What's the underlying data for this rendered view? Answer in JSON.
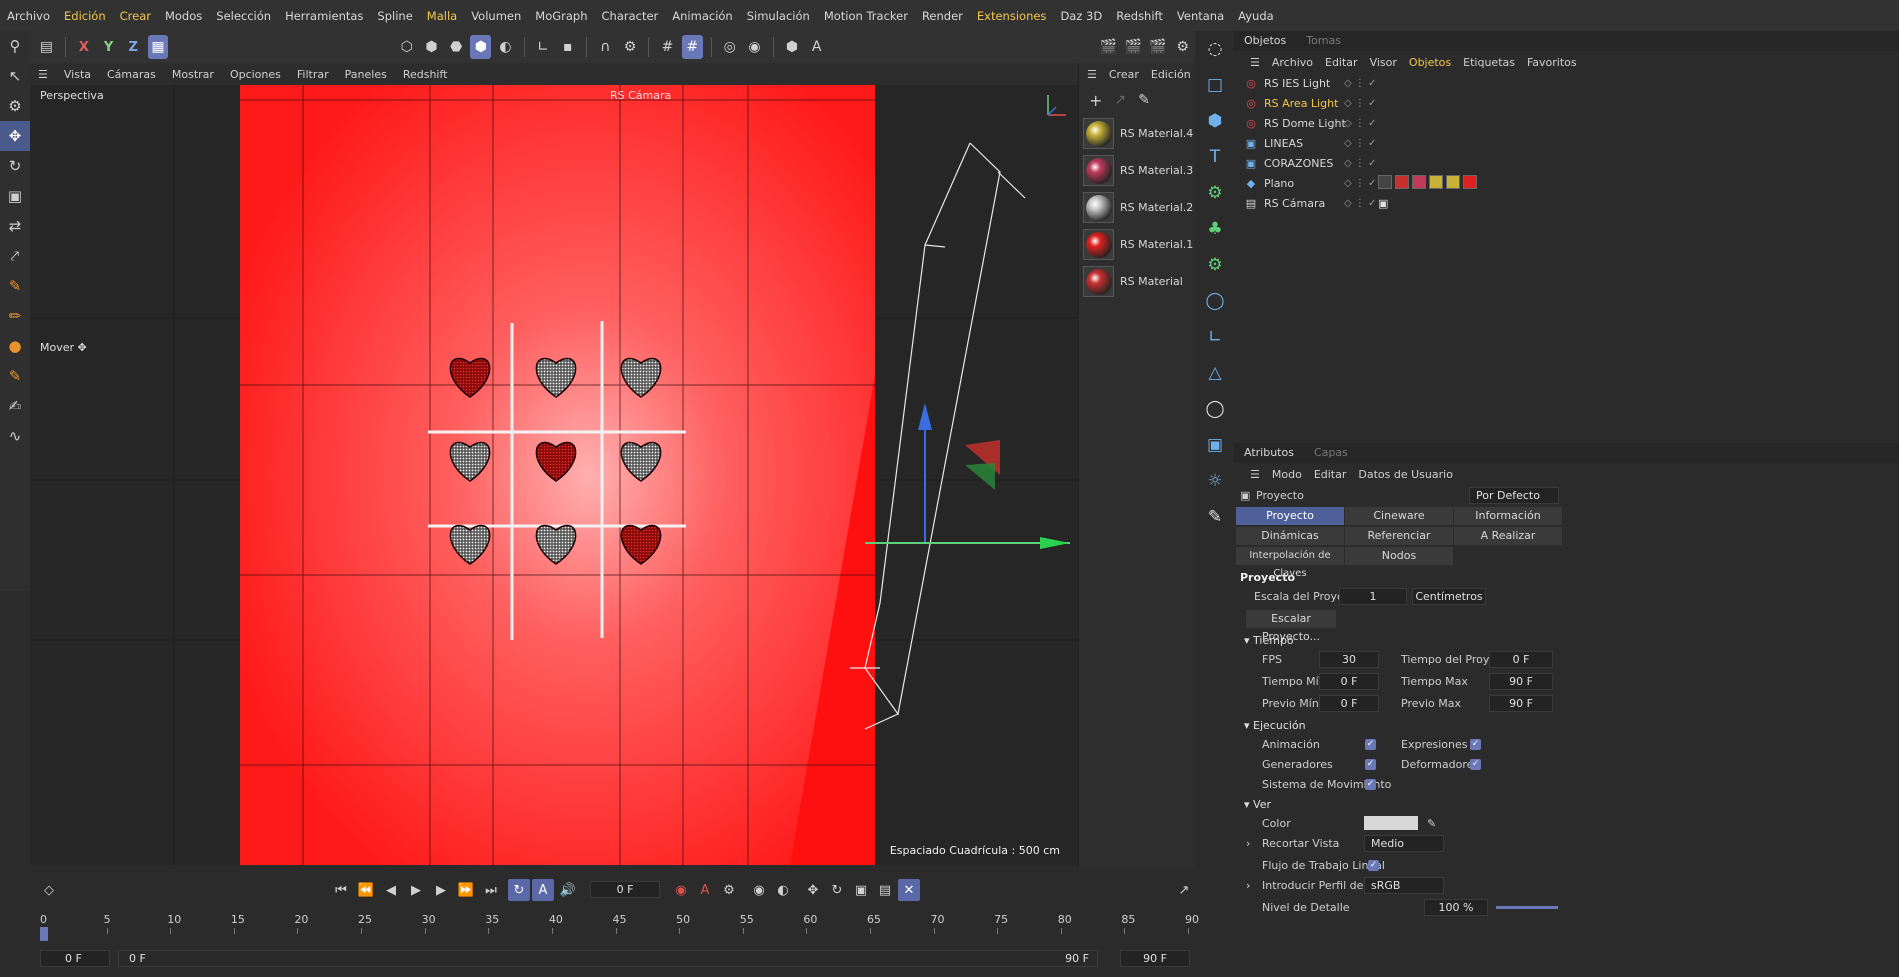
{
  "menubar": {
    "items": [
      {
        "label": "Archivo",
        "hl": false
      },
      {
        "label": "Edición",
        "hl": true
      },
      {
        "label": "Crear",
        "hl": true
      },
      {
        "label": "Modos",
        "hl": false
      },
      {
        "label": "Selección",
        "hl": false
      },
      {
        "label": "Herramientas",
        "hl": false
      },
      {
        "label": "Spline",
        "hl": false
      },
      {
        "label": "Malla",
        "hl": true
      },
      {
        "label": "Volumen",
        "hl": false
      },
      {
        "label": "MoGraph",
        "hl": false
      },
      {
        "label": "Character",
        "hl": false
      },
      {
        "label": "Animación",
        "hl": false
      },
      {
        "label": "Simulación",
        "hl": false
      },
      {
        "label": "Motion Tracker",
        "hl": false
      },
      {
        "label": "Render",
        "hl": false
      },
      {
        "label": "Extensiones",
        "hl": true
      },
      {
        "label": "Daz 3D",
        "hl": false
      },
      {
        "label": "Redshift",
        "hl": false
      },
      {
        "label": "Ventana",
        "hl": false
      },
      {
        "label": "Ayuda",
        "hl": false
      }
    ]
  },
  "toolbar": {
    "x": "X",
    "y": "Y",
    "z": "Z"
  },
  "viewport_menu": {
    "items": [
      "Vista",
      "Cámaras",
      "Mostrar",
      "Opciones",
      "Filtrar",
      "Paneles",
      "Redshift"
    ]
  },
  "viewport": {
    "label": "Perspectiva",
    "tool_label": "Mover",
    "camera_label": "RS Cámara",
    "grid_spacing": "Espaciado Cuadrícula : 500 cm",
    "background_color": "#ff2020",
    "hearts": [
      {
        "style": "red"
      },
      {
        "style": "white"
      },
      {
        "style": "white"
      },
      {
        "style": "white"
      },
      {
        "style": "red"
      },
      {
        "style": "white"
      },
      {
        "style": "white"
      },
      {
        "style": "white"
      },
      {
        "style": "red"
      }
    ]
  },
  "materials": {
    "menu": [
      "Crear",
      "Edición"
    ],
    "items": [
      {
        "label": "RS Material.4",
        "color": "#c8b238"
      },
      {
        "label": "RS Material.3",
        "color": "#c03a5a"
      },
      {
        "label": "RS Material.2",
        "color": "#c8c8c8"
      },
      {
        "label": "RS Material.1",
        "color": "#e02020"
      },
      {
        "label": "RS Material",
        "color": "#c83030"
      }
    ]
  },
  "objects_panel": {
    "tabs": [
      "Objetos",
      "Tomas"
    ],
    "menu": [
      {
        "label": "Archivo",
        "hl": false
      },
      {
        "label": "Editar",
        "hl": false
      },
      {
        "label": "Visor",
        "hl": false
      },
      {
        "label": "Objetos",
        "hl": true
      },
      {
        "label": "Etiquetas",
        "hl": false
      },
      {
        "label": "Favoritos",
        "hl": false
      }
    ],
    "objects": [
      {
        "name": "RS IES Light",
        "hl": false,
        "icon": "light-icon"
      },
      {
        "name": "RS Area Light",
        "hl": true,
        "icon": "light-icon"
      },
      {
        "name": "RS Dome Light",
        "hl": false,
        "icon": "light-icon"
      },
      {
        "name": "LINEAS",
        "hl": false,
        "icon": "group-icon"
      },
      {
        "name": "CORAZONES",
        "hl": false,
        "icon": "group-icon"
      },
      {
        "name": "Plano",
        "hl": false,
        "icon": "plane-icon"
      },
      {
        "name": "RS Cámara",
        "hl": false,
        "icon": "camera-icon"
      }
    ]
  },
  "attributes_panel": {
    "tabs": [
      "Atributos",
      "Capas"
    ],
    "menu": [
      "Modo",
      "Editar",
      "Datos de Usuario"
    ],
    "object_label": "Proyecto",
    "preset": "Por Defecto",
    "tab_row1": [
      "Proyecto",
      "Cineware",
      "Información"
    ],
    "tab_row2": [
      "Dinámicas",
      "Referenciar",
      "A Realizar"
    ],
    "tab_row3": [
      "Interpolación de Claves",
      "Nodos"
    ],
    "section_title": "Proyecto",
    "project_scale_label": "Escala del Proyecto",
    "project_scale_value": "1",
    "project_scale_unit": "Centímetros",
    "scale_button": "Escalar Proyecto...",
    "time_section": "Tiempo",
    "fps_label": "FPS",
    "fps_value": "30",
    "project_time_label": "Tiempo del Proyecto",
    "project_time_value": "0 F",
    "min_time_label": "Tiempo Mín",
    "min_time_value": "0 F",
    "max_time_label": "Tiempo Max",
    "max_time_value": "90 F",
    "prev_min_label": "Previo Mín",
    "prev_min_value": "0 F",
    "prev_max_label": "Previo Max",
    "prev_max_value": "90 F",
    "exec_section": "Ejecución",
    "anim_label": "Animación",
    "expr_label": "Expresiones",
    "gen_label": "Generadores",
    "def_label": "Deformadores",
    "motion_label": "Sistema de Movimiento",
    "view_section": "Ver",
    "color_label": "Color",
    "clip_label": "Recortar Vista",
    "clip_value": "Medio",
    "linear_label": "Flujo de Trabajo Lineal",
    "profile_label": "Introducir Perfil de Color",
    "profile_value": "sRGB",
    "detail_label": "Nivel de Detalle",
    "detail_value": "100 %"
  },
  "timeline": {
    "current_frame": "0 F",
    "ruler": [
      "0",
      "5",
      "10",
      "15",
      "20",
      "25",
      "30",
      "35",
      "40",
      "45",
      "50",
      "55",
      "60",
      "65",
      "70",
      "75",
      "80",
      "85",
      "90"
    ],
    "start_field": "0 F",
    "start_field2": "0 F",
    "end_field": "90 F",
    "end_field2": "90 F"
  }
}
